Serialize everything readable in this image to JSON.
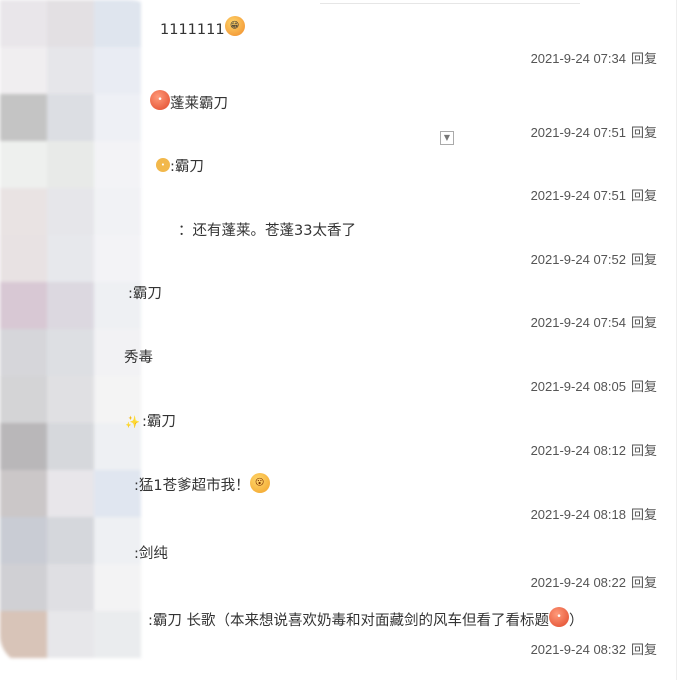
{
  "replies": [
    {
      "name_suffix": ":",
      "text": " 1111111",
      "emoji": "grin-emoji",
      "date": "2021-9-24 07:34",
      "action": "回复"
    },
    {
      "name_suffix": "",
      "text": "蓬莱霸刀",
      "emoji_before": "red-emoji",
      "date": "2021-9-24 07:51",
      "action": "回复"
    },
    {
      "name_suffix": "",
      "text": ":霸刀",
      "emoji_before": "small-emoji",
      "date": "2021-9-24 07:51",
      "action": "回复"
    },
    {
      "name_suffix": "",
      "text": "：还有蓬莱。苍蓬33太香了",
      "date": "2021-9-24 07:52",
      "action": "回复"
    },
    {
      "name_suffix": "",
      "text": ":霸刀",
      "date": "2021-9-24 07:54",
      "action": "回复"
    },
    {
      "name_suffix": "",
      "text": "秀毒",
      "date": "2021-9-24 08:05",
      "action": "回复"
    },
    {
      "name_suffix": "",
      "text": ":霸刀",
      "emoji_before": "sparkle-emoji",
      "date": "2021-9-24 08:12",
      "action": "回复"
    },
    {
      "name_suffix": "",
      "text": ":猛1苍爹超市我！",
      "emoji": "shock-emoji",
      "date": "2021-9-24 08:18",
      "action": "回复"
    },
    {
      "name_suffix": "",
      "text": ":剑纯",
      "date": "2021-9-24 08:22",
      "action": "回复"
    },
    {
      "name_suffix": "",
      "text": ":霸刀 长歌（本来想说喜欢奶毒和对面藏剑的风车但看了看标题",
      "emoji": "red-emoji",
      "after": "）",
      "date": "2021-9-24 08:32",
      "action": "回复"
    }
  ],
  "colors": {
    "text": "#333333",
    "meta": "#555555",
    "blur_palette": [
      "#e9e6ea",
      "#e3e0e3",
      "#dfe5ee",
      "#f0eef0",
      "#e6e6ea",
      "#e9ecf3",
      "#c4c4c4",
      "#dcdee3",
      "#eef0f5",
      "#eef0ee",
      "#e8eae8",
      "#f3f3f6",
      "#e9e3e3",
      "#e6e6ea",
      "#f1f2f5",
      "#e8e2e3",
      "#e7e8ec",
      "#f3f3f6",
      "#d8c8d4",
      "#dcd8e0",
      "#eef0f3",
      "#d6d6da",
      "#dddfe3",
      "#f2f2f4",
      "#d4d4d6",
      "#e0e0e3",
      "#f4f4f4",
      "#b9b7b9",
      "#d6d8dc",
      "#eef0f3",
      "#cbc7c8",
      "#e8e6ea",
      "#e0e6f0",
      "#c9ccd4",
      "#d5d7dc",
      "#eef0f3",
      "#d0d0d4",
      "#dfdfe3",
      "#f3f3f4",
      "#d8c4b8",
      "#e7e7ea",
      "#eaecee"
    ]
  }
}
